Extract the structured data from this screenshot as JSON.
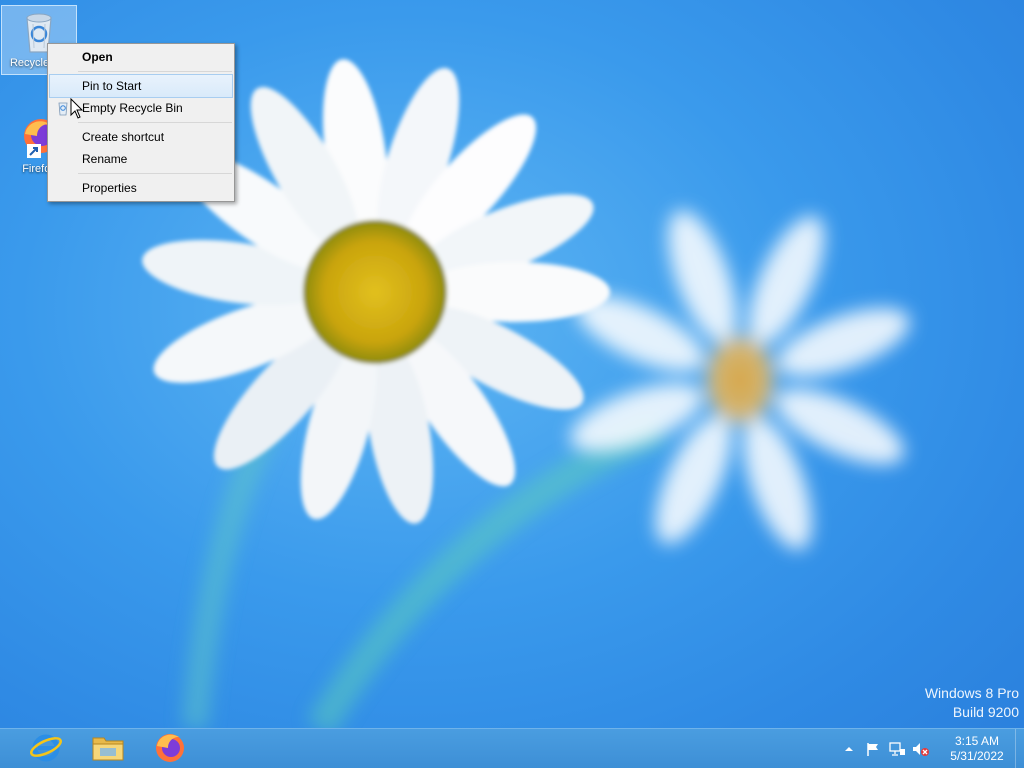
{
  "desktop": {
    "icons": [
      {
        "label": "Recycle Bin",
        "icon": "recycle-bin-icon"
      },
      {
        "label": "Firefox",
        "icon": "firefox-icon"
      }
    ]
  },
  "context_menu": {
    "items": [
      {
        "label": "Open",
        "bold": true
      },
      {
        "label": "Pin to Start",
        "hover": true
      },
      {
        "label": "Empty Recycle Bin",
        "icon": "recycle-bin-small-icon"
      },
      {
        "label": "Create shortcut"
      },
      {
        "label": "Rename"
      },
      {
        "label": "Properties"
      }
    ]
  },
  "watermark": {
    "line1": "Windows 8 Pro",
    "line2": "Build 9200"
  },
  "taskbar": {
    "pinned": [
      {
        "name": "internet-explorer",
        "icon": "internet-explorer-icon"
      },
      {
        "name": "file-explorer",
        "icon": "folder-icon"
      },
      {
        "name": "firefox",
        "icon": "firefox-icon"
      }
    ],
    "tray": {
      "icons": [
        "show-hidden-icons-icon",
        "action-center-flag-icon",
        "network-icon",
        "volume-muted-icon"
      ]
    },
    "clock": {
      "time": "3:15 AM",
      "date": "5/31/2022"
    }
  },
  "colors": {
    "taskbar": "#3d8fd6",
    "menu_bg": "#f0f0f0",
    "menu_hover": "#d9eafa"
  }
}
